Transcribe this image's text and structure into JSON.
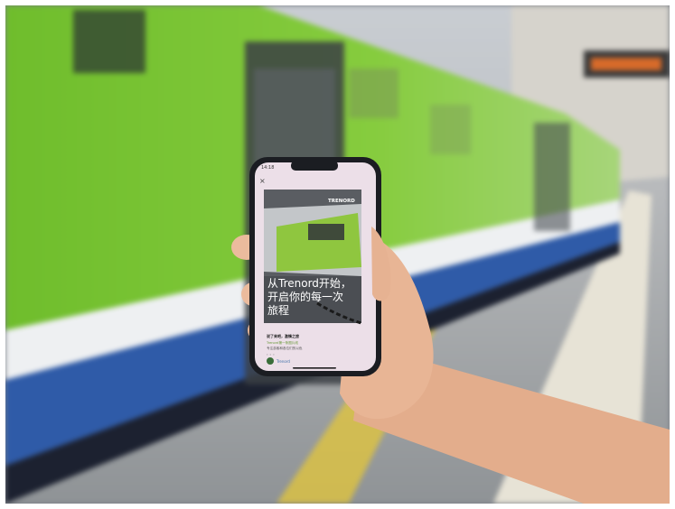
{
  "phone": {
    "status_time": "14:18",
    "close_glyph": "×",
    "brand": "TRENORD",
    "headline_line1": "从Trenord开始，",
    "headline_line2": "开启你的每一次",
    "headline_line3": "旅程",
    "body_title": "说了来吧，激情之旅",
    "body_line1": "Trenord第一条图片线",
    "body_line2": "专注游客和各位们的以色",
    "body_line3": "。。。",
    "account_name": "Trenord"
  },
  "colors": {
    "train_green": "#7cc634",
    "train_blue": "#2f5ba8",
    "train_white": "#e9ecef",
    "platform": "#9ea1a4",
    "platform_line": "#e4c73a",
    "skin": "#e9b899",
    "phone_frame": "#1b1d22",
    "screen_bg": "#ecdfe8",
    "accent_green": "#5fae3a"
  }
}
